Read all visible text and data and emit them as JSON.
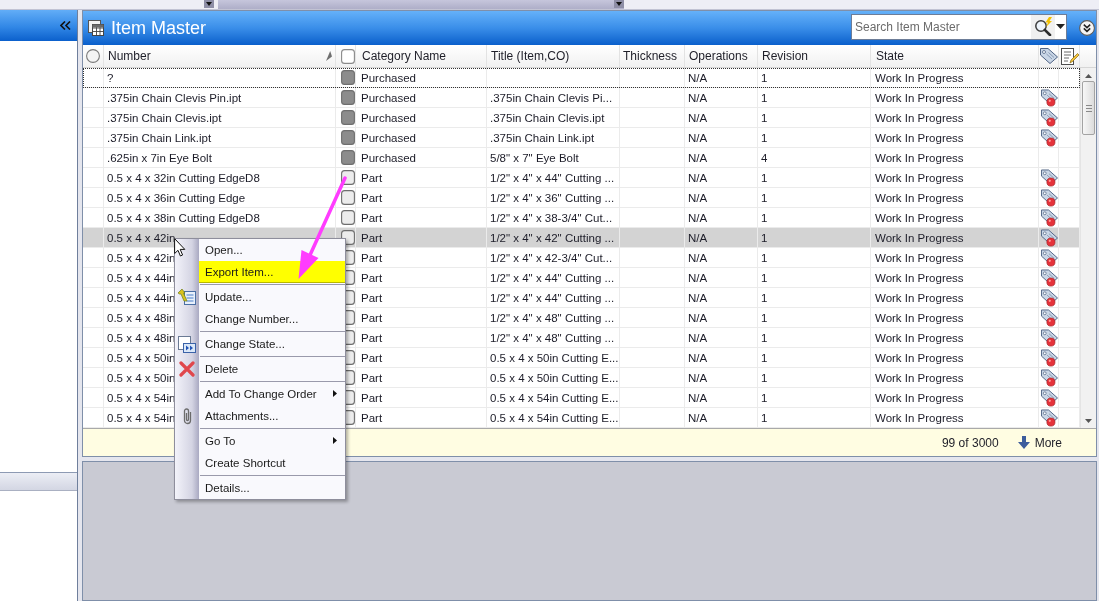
{
  "panel": {
    "title": "Item Master"
  },
  "search": {
    "placeholder": "Search Item Master"
  },
  "table": {
    "columns": [
      {
        "label": "Number",
        "sorted": true
      },
      {
        "label": "Category Name",
        "sorted": false
      },
      {
        "label": "Title (Item,CO)",
        "sorted": false
      },
      {
        "label": "Thickness",
        "sorted": false
      },
      {
        "label": "Operations",
        "sorted": false
      },
      {
        "label": "Revision",
        "sorted": false
      },
      {
        "label": "State",
        "sorted": false
      }
    ],
    "rows": [
      {
        "number": "?",
        "category": "Purchased",
        "operations": "N/A",
        "revision": "1",
        "state": "Work In Progress",
        "color": "#8c8c8c",
        "tag_marker": false,
        "selected": false,
        "focused": true
      },
      {
        "number": ".375in Chain Clevis Pin.ipt",
        "category": "Purchased",
        "title": ".375in Chain Clevis Pi...",
        "operations": "N/A",
        "revision": "1",
        "state": "Work In Progress",
        "color": "#8c8c8c",
        "tag_marker": true,
        "selected": false,
        "focused": false
      },
      {
        "number": ".375in Chain Clevis.ipt",
        "category": "Purchased",
        "title": ".375in Chain Clevis.ipt",
        "operations": "N/A",
        "revision": "1",
        "state": "Work In Progress",
        "color": "#8c8c8c",
        "tag_marker": true,
        "selected": false,
        "focused": false
      },
      {
        "number": ".375in Chain Link.ipt",
        "category": "Purchased",
        "title": ".375in Chain Link.ipt",
        "operations": "N/A",
        "revision": "1",
        "state": "Work In Progress",
        "color": "#8c8c8c",
        "tag_marker": true,
        "selected": false,
        "focused": false
      },
      {
        "number": ".625in x 7in Eye Bolt",
        "category": "Purchased",
        "title": "5/8\" x 7\" Eye Bolt",
        "operations": "N/A",
        "revision": "4",
        "state": "Work In Progress",
        "color": "#8c8c8c",
        "tag_marker": false,
        "selected": false,
        "focused": false
      },
      {
        "number": "0.5 x 4 x 32in Cutting EdgeD8",
        "category": "Part",
        "title": "1/2\" x 4\" x 44\" Cutting ...",
        "operations": "N/A",
        "revision": "1",
        "state": "Work In Progress",
        "color": "#ececec",
        "tag_marker": true,
        "selected": false,
        "focused": false
      },
      {
        "number": "0.5 x 4 x 36in Cutting Edge",
        "category": "Part",
        "title": "1/2\" x 4\" x 36\" Cutting ...",
        "operations": "N/A",
        "revision": "1",
        "state": "Work In Progress",
        "color": "#ececec",
        "tag_marker": true,
        "selected": false,
        "focused": false
      },
      {
        "number": "0.5 x 4 x 38in Cutting EdgeD8",
        "category": "Part",
        "title": "1/2\" x 4\" x 38-3/4\" Cut...",
        "operations": "N/A",
        "revision": "1",
        "state": "Work In Progress",
        "color": "#ececec",
        "tag_marker": true,
        "selected": false,
        "focused": false
      },
      {
        "number": "0.5 x 4 x 42in",
        "category": "Part",
        "title": "1/2\" x 4\" x 42\" Cutting ...",
        "operations": "N/A",
        "revision": "1",
        "state": "Work In Progress",
        "color": "#ececec",
        "tag_marker": true,
        "selected": true,
        "focused": false
      },
      {
        "number": "0.5 x 4 x 42in",
        "category": "Part",
        "title": "1/2\" x 4\" x 42-3/4\" Cut...",
        "operations": "N/A",
        "revision": "1",
        "state": "Work In Progress",
        "color": "#ececec",
        "tag_marker": true,
        "selected": false,
        "focused": false
      },
      {
        "number": "0.5 x 4 x 44in",
        "category": "Part",
        "title": "1/2\" x 4\" x 44\" Cutting ...",
        "operations": "N/A",
        "revision": "1",
        "state": "Work In Progress",
        "color": "#ececec",
        "tag_marker": true,
        "selected": false,
        "focused": false
      },
      {
        "number": "0.5 x 4 x 44in",
        "category": "Part",
        "title": "1/2\" x 4\" x 44\" Cutting ...",
        "operations": "N/A",
        "revision": "1",
        "state": "Work In Progress",
        "color": "#ececec",
        "tag_marker": true,
        "selected": false,
        "focused": false
      },
      {
        "number": "0.5 x 4 x 48in",
        "category": "Part",
        "title": "1/2\" x 4\" x 48\" Cutting ...",
        "operations": "N/A",
        "revision": "1",
        "state": "Work In Progress",
        "color": "#ececec",
        "tag_marker": true,
        "selected": false,
        "focused": false
      },
      {
        "number": "0.5 x 4 x 48in",
        "category": "Part",
        "title": "1/2\" x 4\" x 48\" Cutting ...",
        "operations": "N/A",
        "revision": "1",
        "state": "Work In Progress",
        "color": "#ececec",
        "tag_marker": true,
        "selected": false,
        "focused": false
      },
      {
        "number": "0.5 x 4 x 50in",
        "category": "Part",
        "title": "0.5 x 4 x 50in Cutting E...",
        "operations": "N/A",
        "revision": "1",
        "state": "Work In Progress",
        "color": "#ececec",
        "tag_marker": true,
        "selected": false,
        "focused": false
      },
      {
        "number": "0.5 x 4 x 50in",
        "category": "Part",
        "title": "0.5 x 4 x 50in Cutting E...",
        "operations": "N/A",
        "revision": "1",
        "state": "Work In Progress",
        "color": "#ececec",
        "tag_marker": true,
        "selected": false,
        "focused": false
      },
      {
        "number": "0.5 x 4 x 54in",
        "category": "Part",
        "title": "0.5 x 4 x 54in Cutting E...",
        "operations": "N/A",
        "revision": "1",
        "state": "Work In Progress",
        "color": "#ececec",
        "tag_marker": true,
        "selected": false,
        "focused": false
      },
      {
        "number": "0.5 x 4 x 54in",
        "category": "Part",
        "title": "0.5 x 4 x 54in Cutting E...",
        "operations": "N/A",
        "revision": "1",
        "state": "Work In Progress",
        "color": "#ececec",
        "tag_marker": true,
        "selected": false,
        "focused": false
      }
    ]
  },
  "status_bar": {
    "count": "99 of 3000",
    "more": "More"
  },
  "context_menu": {
    "groups": [
      [
        {
          "label": "Open...",
          "selected": false,
          "submenu": false
        },
        {
          "label": "Export Item...",
          "selected": true,
          "submenu": false
        }
      ],
      [
        {
          "label": "Update...",
          "selected": false,
          "submenu": false
        },
        {
          "label": "Change Number...",
          "selected": false,
          "submenu": false
        }
      ],
      [
        {
          "label": "Change State...",
          "selected": false,
          "submenu": false
        }
      ],
      [
        {
          "label": "Delete",
          "selected": false,
          "submenu": false
        }
      ],
      [
        {
          "label": "Add To Change Order",
          "selected": false,
          "submenu": true
        },
        {
          "label": "Attachments...",
          "selected": false,
          "submenu": false
        }
      ],
      [
        {
          "label": "Go To",
          "selected": false,
          "submenu": true
        },
        {
          "label": "Create Shortcut",
          "selected": false,
          "submenu": false
        }
      ],
      [
        {
          "label": "Details...",
          "selected": false,
          "submenu": false
        }
      ]
    ]
  }
}
